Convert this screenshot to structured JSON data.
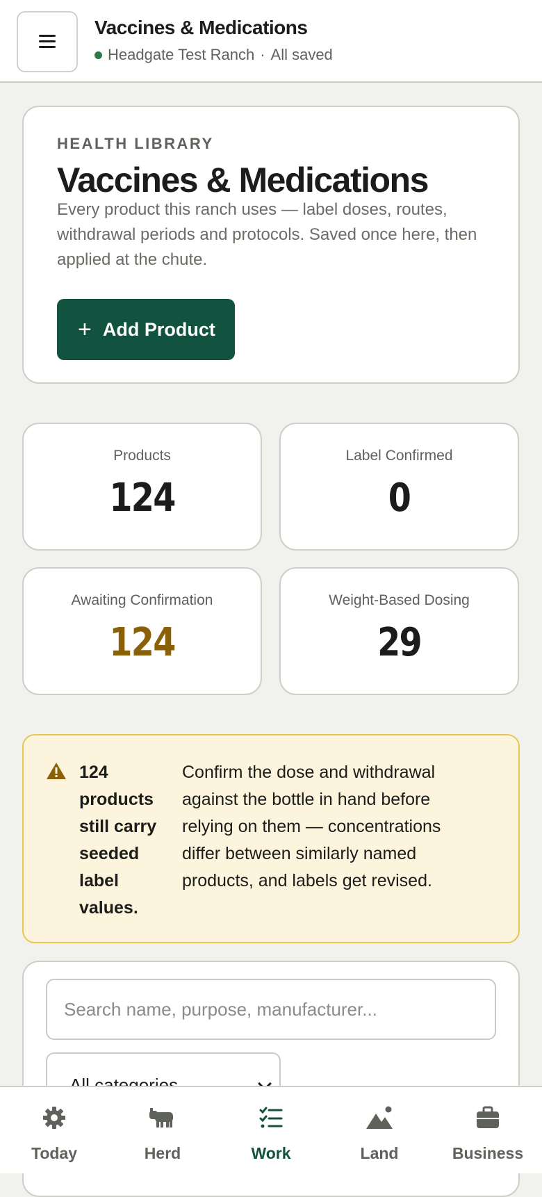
{
  "header": {
    "title": "Vaccines & Medications",
    "ranch": "Headgate Test Ranch",
    "separator": "·",
    "status": "All saved"
  },
  "hero": {
    "eyebrow": "HEALTH LIBRARY",
    "title": "Vaccines & Medications",
    "description": "Every product this ranch uses — label doses, routes, withdrawal periods and protocols. Saved once here, then applied at the chute.",
    "add_button": "Add Product"
  },
  "stats": [
    {
      "label": "Products",
      "value": "124"
    },
    {
      "label": "Label Confirmed",
      "value": "0"
    },
    {
      "label": "Awaiting Confirmation",
      "value": "124"
    },
    {
      "label": "Weight-Based Dosing",
      "value": "29"
    }
  ],
  "alert": {
    "strong": "124 products still carry seeded label values.",
    "text": "Confirm the dose and withdrawal against the bottle in hand before relying on them — concentrations differ between similarly named products, and labels get revised."
  },
  "search": {
    "placeholder": "Search name, purpose, manufacturer...",
    "category_selected": "All categories"
  },
  "nav": {
    "items": [
      {
        "label": "Today",
        "icon": "gear-icon"
      },
      {
        "label": "Herd",
        "icon": "cow-icon"
      },
      {
        "label": "Work",
        "icon": "checklist-icon"
      },
      {
        "label": "Land",
        "icon": "mountain-icon"
      },
      {
        "label": "Business",
        "icon": "briefcase-icon"
      }
    ],
    "active": "Work"
  },
  "colors": {
    "primary": "#11533f",
    "warning": "#8a6008",
    "alert_bg": "#fcf4dc",
    "status_dot": "#2f7a44"
  }
}
